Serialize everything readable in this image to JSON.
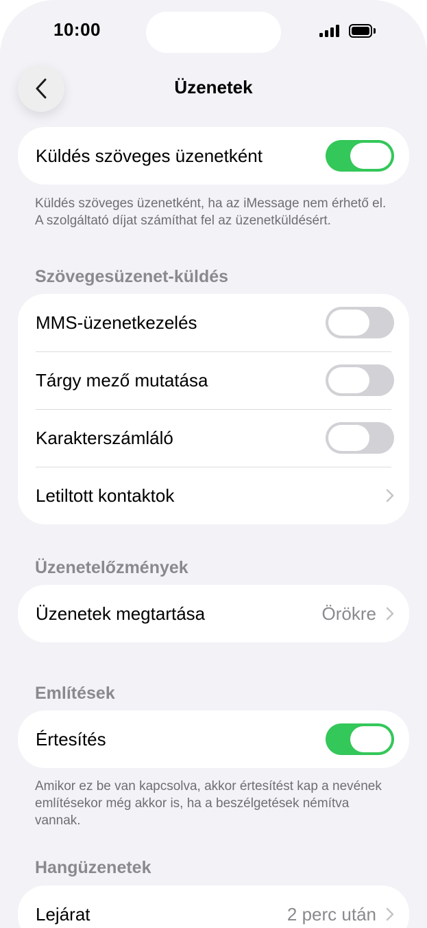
{
  "status_bar": {
    "time": "10:00"
  },
  "nav": {
    "title": "Üzenetek"
  },
  "send_as_sms": {
    "label": "Küldés szöveges üzenetként",
    "enabled": true,
    "footer": "Küldés szöveges üzenetként, ha az iMessage nem érhető el. A szolgáltató díjat számíthat fel az üzenetküldésért."
  },
  "sms_section": {
    "header": "Szövegesüzenet-küldés",
    "rows": [
      {
        "label": "MMS-üzenetkezelés",
        "enabled": false
      },
      {
        "label": "Tárgy mező mutatása",
        "enabled": false
      },
      {
        "label": "Karakterszámláló",
        "enabled": false
      },
      {
        "label": "Letiltott kontaktok"
      }
    ]
  },
  "history_section": {
    "header": "Üzenetelőzmények",
    "keep_label": "Üzenetek megtartása",
    "keep_value": "Örökre"
  },
  "mentions_section": {
    "header": "Említések",
    "notify_label": "Értesítés",
    "notify_enabled": true,
    "footer": "Amikor ez be van kapcsolva, akkor értesítést kap a nevének említésekor még akkor is, ha a beszélgetések némítva vannak."
  },
  "audio_section": {
    "header": "Hangüzenetek",
    "expire_label": "Lejárat",
    "expire_value": "2 perc után"
  },
  "colors": {
    "toggle_on": "#34c759",
    "toggle_off": "#d1d1d6",
    "background": "#f2f2f7"
  }
}
